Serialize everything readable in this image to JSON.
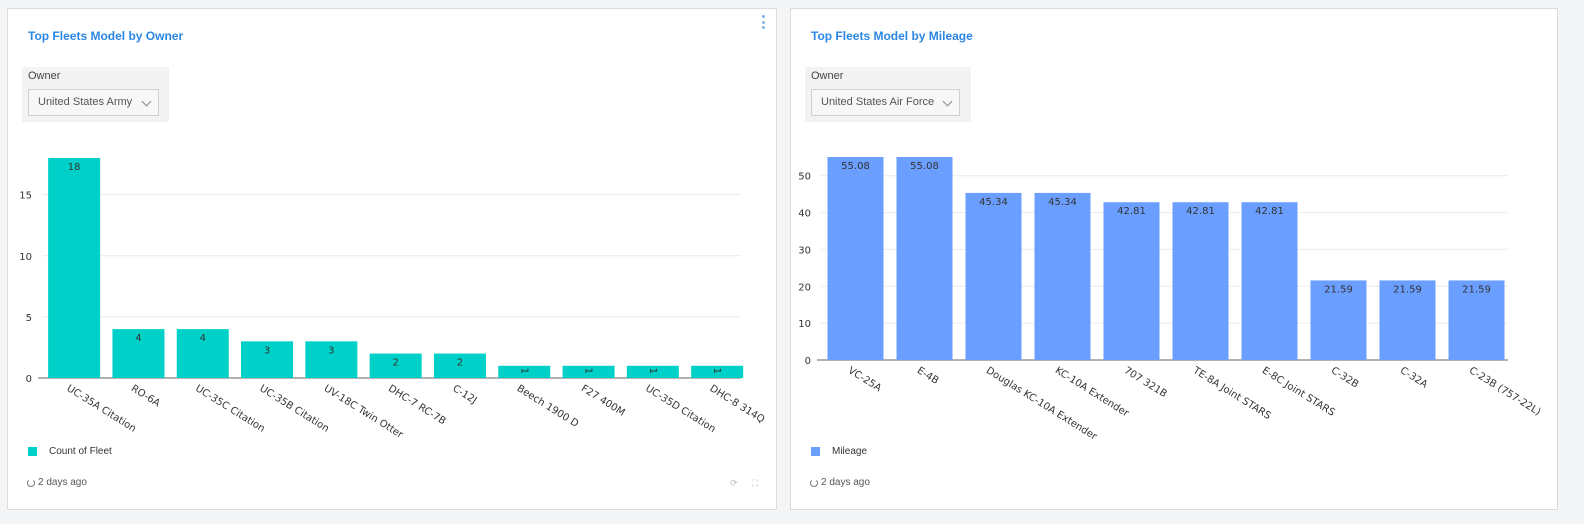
{
  "panels": [
    {
      "title": "Top Fleets Model by Owner",
      "filter": {
        "label": "Owner",
        "value": "United States Army"
      },
      "legend": {
        "label": "Count of Fleet",
        "color": "#00d1c8"
      },
      "updated": "2 days ago"
    },
    {
      "title": "Top Fleets Model by Mileage",
      "filter": {
        "label": "Owner",
        "value": "United States Air Force"
      },
      "legend": {
        "label": "Mileage",
        "color": "#6a9eff"
      },
      "updated": "2 days ago"
    }
  ],
  "chart_data": [
    {
      "type": "bar",
      "categories": [
        "UC-35A Citation",
        "RO-6A",
        "UC-35C Citation",
        "UC-35B Citation",
        "UV-18C Twin Otter",
        "DHC-7 RC-7B",
        "C-12J",
        "Beech 1900 D",
        "F27 400M",
        "UC-35D Citation",
        "DHC-8 314Q"
      ],
      "series": [
        {
          "name": "Count of Fleet",
          "values": [
            18,
            4,
            4,
            3,
            3,
            2,
            2,
            1,
            1,
            1,
            1
          ],
          "color": "#00d1c8"
        }
      ],
      "yticks": [
        0,
        5,
        10,
        15
      ],
      "ylim": [
        0,
        18
      ],
      "grid": true
    },
    {
      "type": "bar",
      "categories": [
        "VC-25A",
        "E-4B",
        "Douglas KC-10A Extender",
        "KC-10A Extender",
        "707 321B",
        "TE-8A Joint STARS",
        "E-8C Joint STARS",
        "C-32B",
        "C-32A",
        "C-23B (757-22L)"
      ],
      "series": [
        {
          "name": "Mileage",
          "values": [
            55.08,
            55.08,
            45.34,
            45.34,
            42.81,
            42.81,
            42.81,
            21.59,
            21.59,
            21.59
          ],
          "color": "#6a9eff"
        }
      ],
      "yticks": [
        0,
        10,
        20,
        30,
        40,
        50
      ],
      "ylim": [
        0,
        55.08
      ],
      "grid": true
    }
  ]
}
